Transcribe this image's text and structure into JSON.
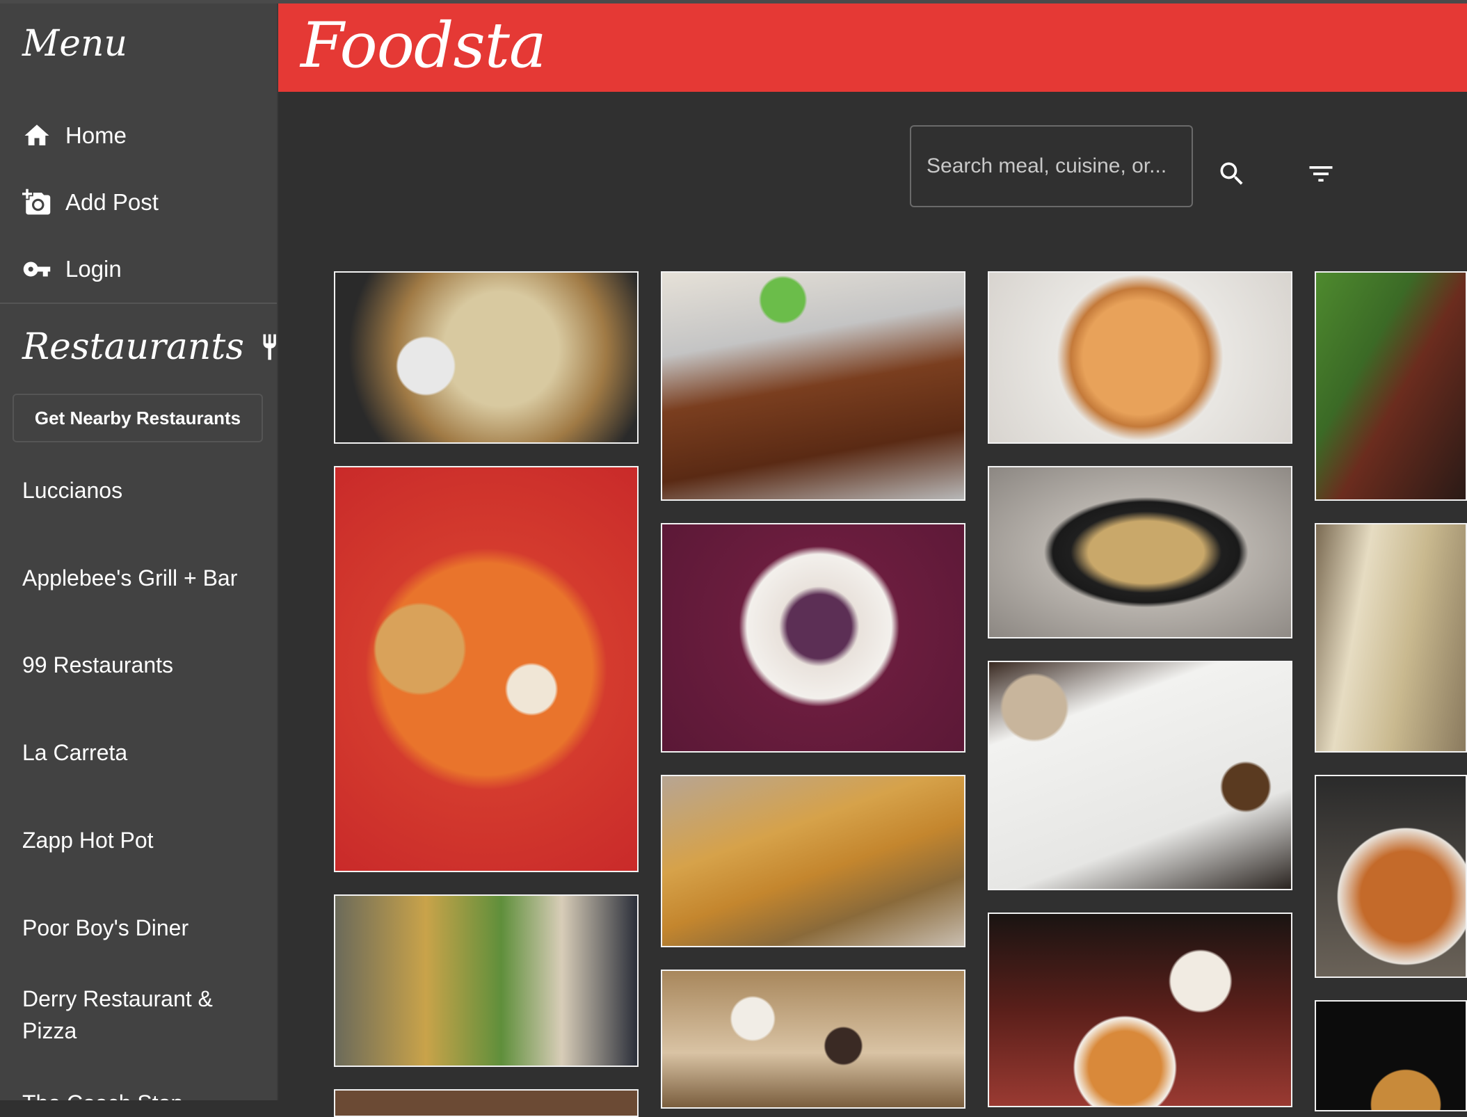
{
  "sidebar": {
    "menu_title": "Menu",
    "nav": [
      {
        "label": "Home",
        "icon": "home-icon"
      },
      {
        "label": "Add Post",
        "icon": "add-photo-icon"
      },
      {
        "label": "Login",
        "icon": "key-icon"
      }
    ],
    "restaurants_title": "Restaurants",
    "restaurants_icon": "utensils-icon",
    "nearby_button": "Get Nearby Restaurants",
    "restaurants": [
      "Luccianos",
      "Applebee's Grill + Bar",
      "99 Restaurants",
      "La Carreta",
      "Zapp Hot Pot",
      "Poor Boy's Diner",
      "Derry Restaurant & Pizza",
      "The Coach Stop"
    ]
  },
  "header": {
    "logo": "Foodsta",
    "color": "#e53935"
  },
  "search": {
    "placeholder": "Search meal, cuisine, or...",
    "search_icon": "search-icon",
    "filter_icon": "filter-icon"
  },
  "gallery": {
    "posts": [
      {
        "alt": "nachos with jalapenos"
      },
      {
        "alt": "curry on foil tray with rice"
      },
      {
        "alt": "pizza in box"
      },
      {
        "alt": "plated dish with greens"
      },
      {
        "alt": "breakfast sandwich with potatoes"
      },
      {
        "alt": "blueberry pastry on paper plate"
      },
      {
        "alt": "stir fried noodles"
      },
      {
        "alt": "bean sprout noodles"
      },
      {
        "alt": "fries and burger"
      },
      {
        "alt": "bao buns platter"
      },
      {
        "alt": "poutine bowl"
      },
      {
        "alt": "tacos with jalapenos"
      },
      {
        "alt": "box of donuts"
      },
      {
        "alt": "pho noodle soup"
      },
      {
        "alt": "burger"
      }
    ]
  }
}
